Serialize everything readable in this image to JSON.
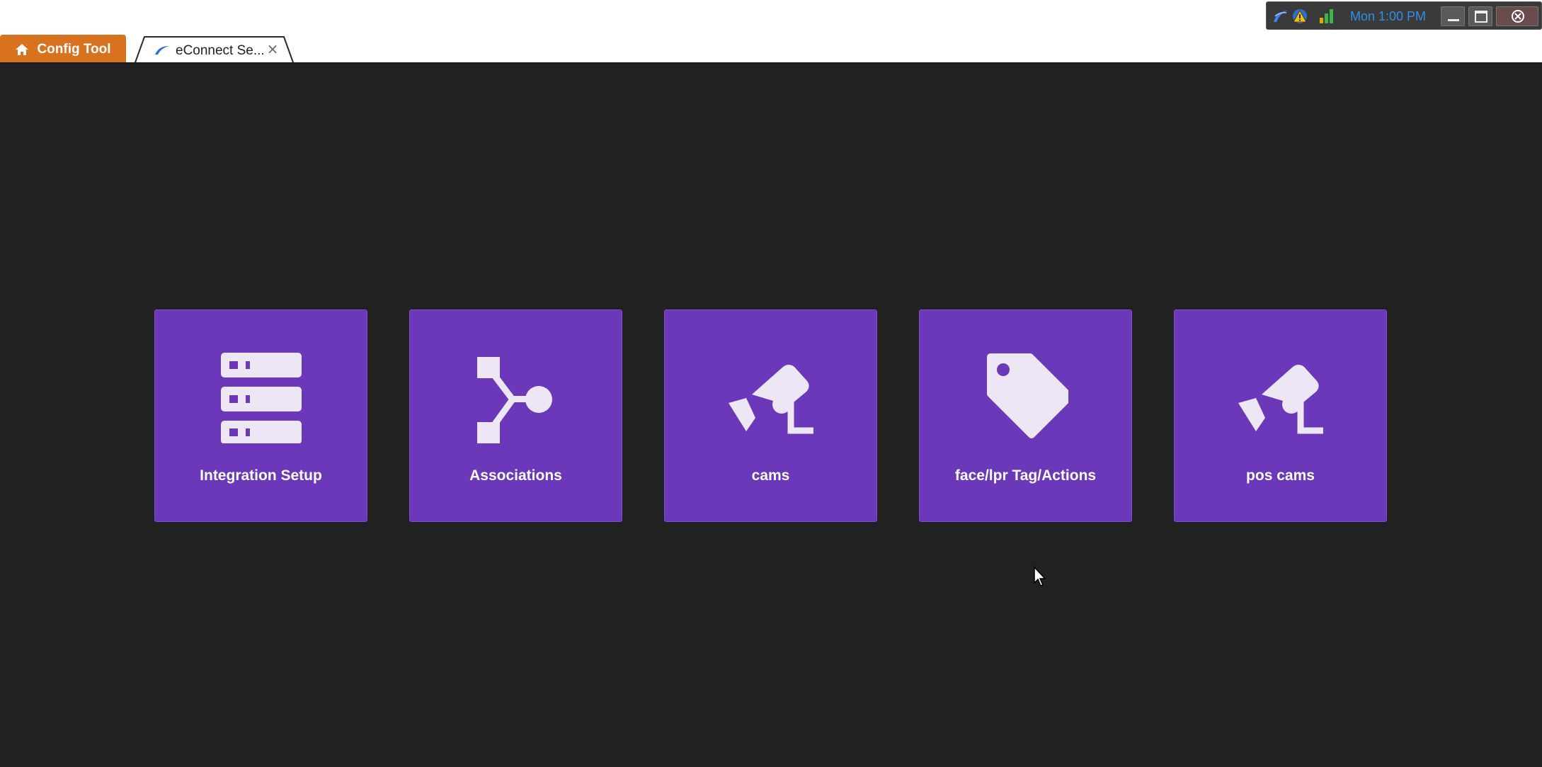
{
  "tabs": {
    "home_label": "Config Tool",
    "active_label": "eConnect Se...",
    "close_glyph": "×"
  },
  "tray": {
    "clock": "Mon 1:00 PM",
    "icons": [
      "app-logo-icon",
      "warning-icon",
      "signal-bars-icon"
    ]
  },
  "tiles": [
    {
      "label": "Integration Setup",
      "icon": "server-icon"
    },
    {
      "label": "Associations",
      "icon": "branch-icon"
    },
    {
      "label": "cams",
      "icon": "security-camera-icon"
    },
    {
      "label": "face/lpr Tag/Actions",
      "icon": "tag-icon"
    },
    {
      "label": "pos cams",
      "icon": "security-camera-icon"
    }
  ],
  "colors": {
    "accent_orange": "#d9721f",
    "tile_purple": "#6a38b8",
    "icon_fill": "#ece6f5",
    "background": "#212121",
    "clock_blue": "#2f8fe6"
  }
}
